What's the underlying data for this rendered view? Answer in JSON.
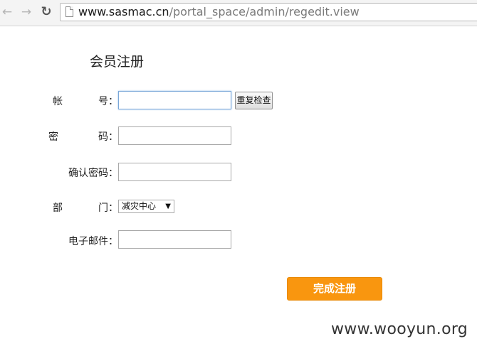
{
  "browser": {
    "url_host": "www.sasmac.cn",
    "url_path": "/portal_space/admin/regedit.view",
    "icons": {
      "back": "arrow-left",
      "forward": "arrow-right",
      "reload": "reload",
      "page": "document"
    }
  },
  "form": {
    "title": "会员注册",
    "account": {
      "label_left": "帐",
      "label_right": "号：",
      "value": "",
      "check_button": "重复检查"
    },
    "password": {
      "label_left": "密",
      "label_right": "码：",
      "value": ""
    },
    "confirm_password": {
      "label": "确认密码：",
      "value": ""
    },
    "department": {
      "label_left": "部",
      "label_right": "门：",
      "selected": "减灾中心"
    },
    "email": {
      "label": "电子邮件：",
      "value": ""
    },
    "submit_label": "完成注册",
    "accent_color": "#f9960f"
  },
  "watermark": "www.wooyun.org"
}
